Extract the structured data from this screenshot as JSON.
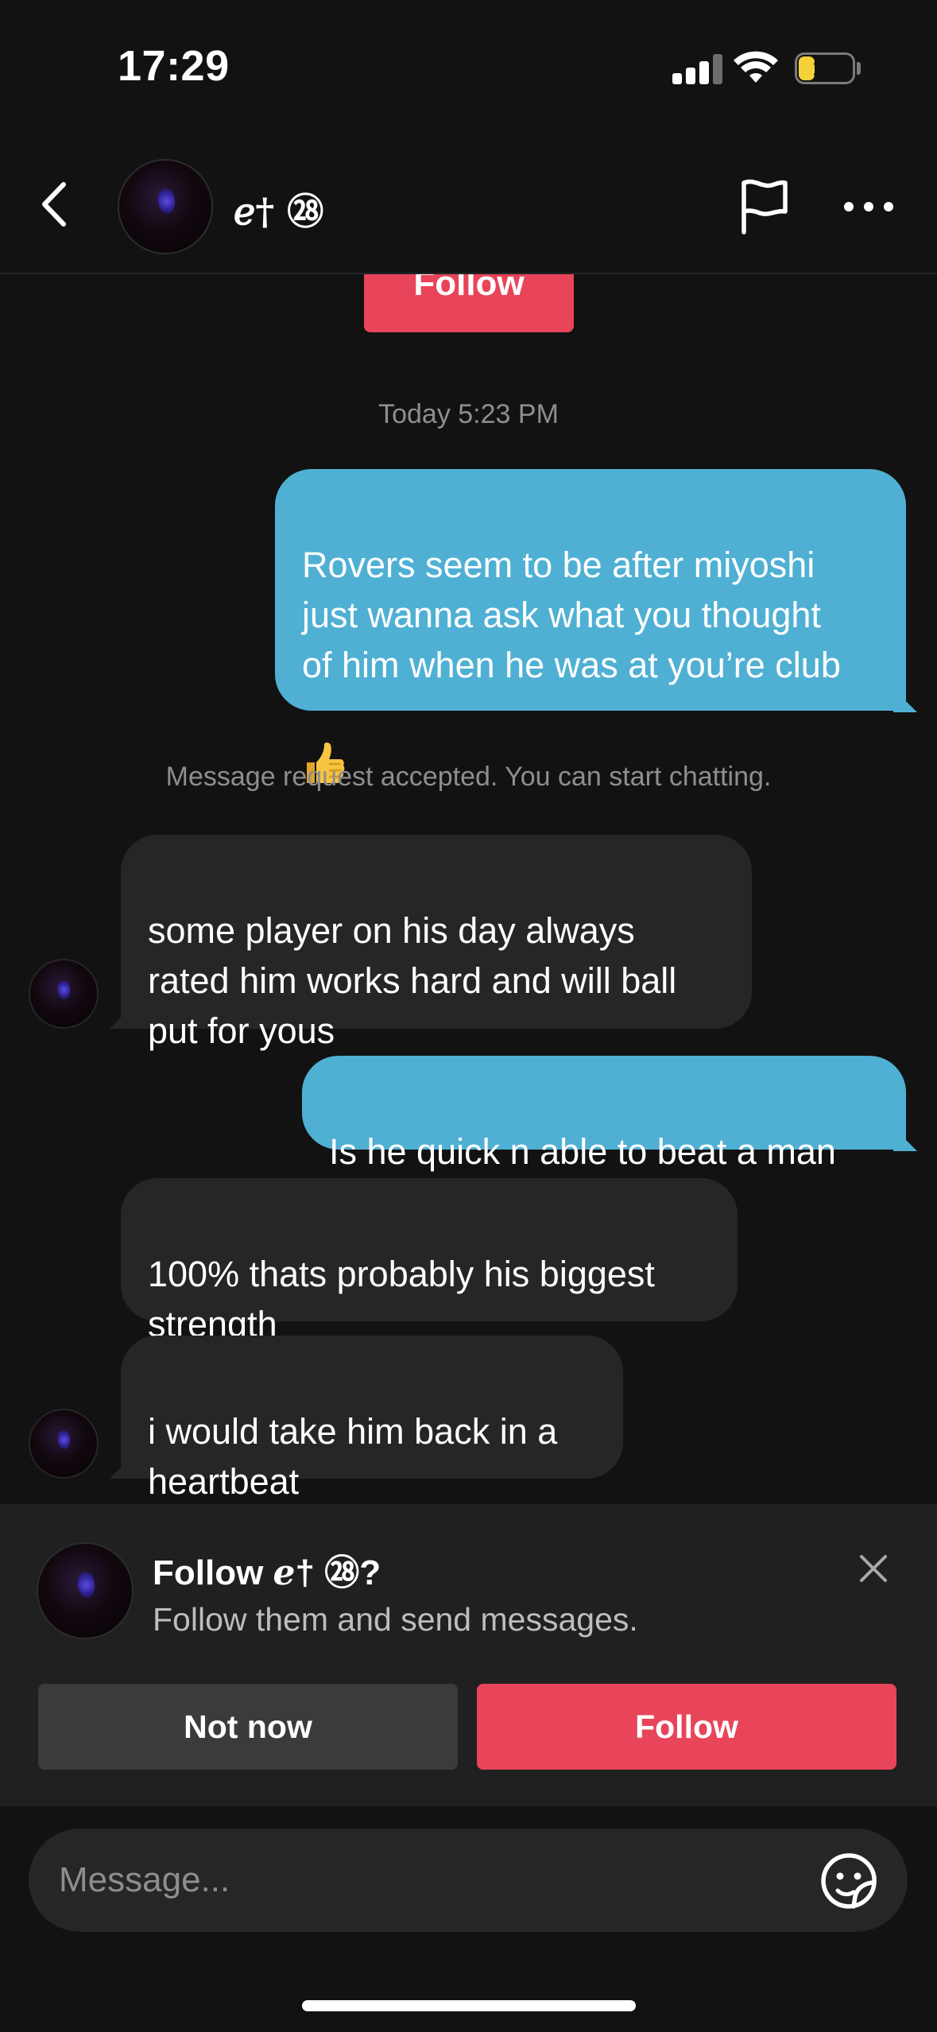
{
  "status_bar": {
    "time": "17:29",
    "battery_level": "12",
    "battery_color": "#f5d13a"
  },
  "header": {
    "contact_name": "ℯ† ㉘",
    "icons": {
      "back": "chevron-left-icon",
      "report": "flag-icon",
      "more": "more-dots-icon"
    }
  },
  "conversation": {
    "top_follow_label": "Follow",
    "timestamp": "Today 5:23 PM",
    "system_notice": "Message request accepted. You can start chatting.",
    "messages": [
      {
        "direction": "outgoing",
        "text": "Rovers seem to be after miyoshi\njust wanna ask what you thought\nof him when he was at you’re club",
        "emoji": "thumbs-up-icon"
      },
      {
        "direction": "incoming",
        "text": "some player on his day always\nrated him works hard and will ball\nput for yous"
      },
      {
        "direction": "outgoing",
        "text": "Is he quick n able to beat a man"
      },
      {
        "direction": "incoming",
        "text": "100% thats probably his biggest\nstrength"
      },
      {
        "direction": "incoming",
        "text": "i would take him back in a\nheartbeat"
      }
    ]
  },
  "follow_prompt": {
    "title": "Follow ℯ† ㉘?",
    "subtitle": "Follow them and send messages.",
    "not_now_label": "Not now",
    "follow_label": "Follow",
    "accent_color": "#e8445a"
  },
  "composer": {
    "placeholder": "Message...",
    "sticker_icon": "sticker-face-icon"
  },
  "colors": {
    "background": "#121212",
    "outgoing_bubble": "#4fb0d4",
    "incoming_bubble": "#262626"
  }
}
